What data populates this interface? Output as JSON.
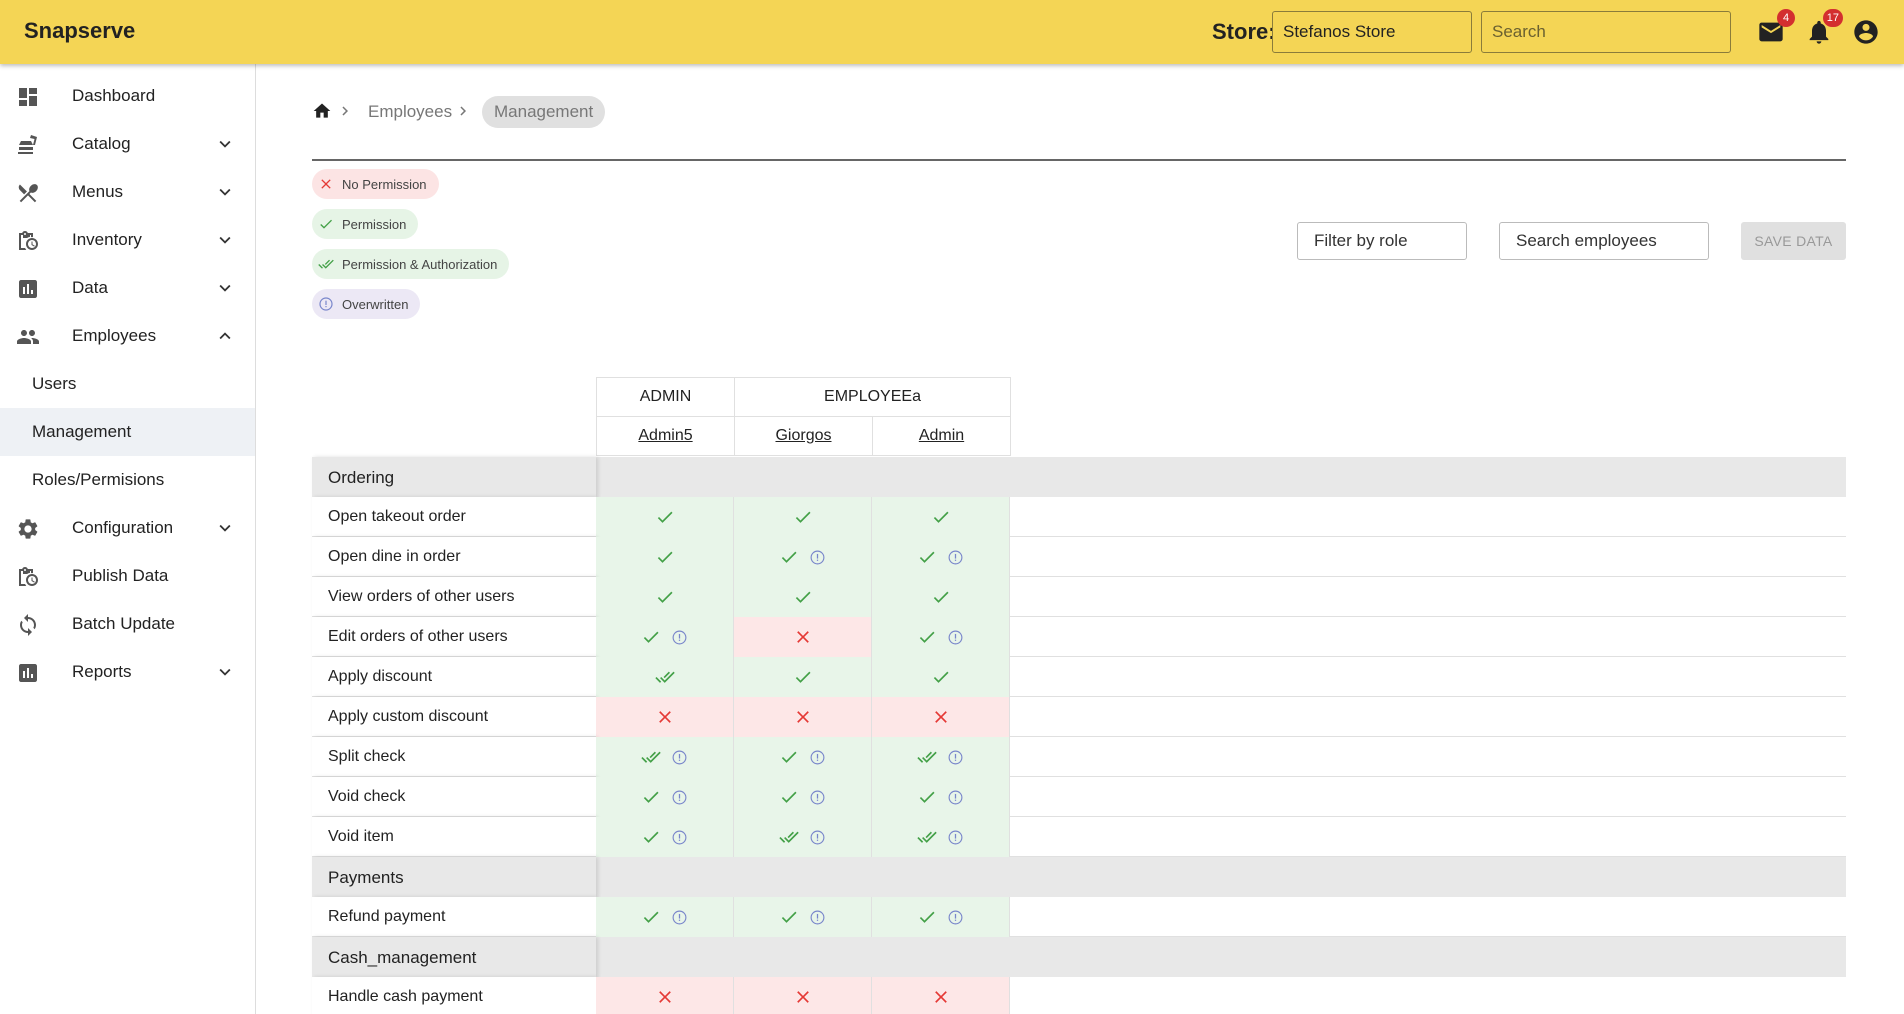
{
  "app": {
    "title": "Snapserve"
  },
  "topbar": {
    "store_label": "Store:",
    "store_value": "Stefanos Store",
    "search_placeholder": "Search",
    "mail_count": "4",
    "notif_count": "17"
  },
  "sidebar": {
    "items": [
      {
        "label": "Dashboard"
      },
      {
        "label": "Catalog"
      },
      {
        "label": "Menus"
      },
      {
        "label": "Inventory"
      },
      {
        "label": "Data"
      },
      {
        "label": "Employees"
      },
      {
        "label": "Users"
      },
      {
        "label": "Management"
      },
      {
        "label": "Roles/Permisions"
      },
      {
        "label": "Configuration"
      },
      {
        "label": "Publish Data"
      },
      {
        "label": "Batch Update"
      },
      {
        "label": "Reports"
      }
    ]
  },
  "breadcrumb": {
    "parent": "Employees",
    "current": "Management"
  },
  "legend": {
    "no_permission": "No Permission",
    "permission": "Permission",
    "permission_auth": "Permission & Authorization",
    "overwritten": "Overwritten"
  },
  "controls": {
    "filter_role": "Filter by role",
    "search_employees": "Search employees",
    "save": "SAVE DATA"
  },
  "table": {
    "roles": [
      {
        "name": "ADMIN"
      },
      {
        "name": "EMPLOYEEa"
      }
    ],
    "users": [
      {
        "name": "Admin5"
      },
      {
        "name": "Giorgos"
      },
      {
        "name": "Admin"
      }
    ],
    "sections": [
      {
        "name": "Ordering",
        "rows": [
          {
            "label": "Open takeout order",
            "cells": [
              [
                "p",
                false
              ],
              [
                "p",
                false
              ],
              [
                "p",
                false
              ]
            ]
          },
          {
            "label": "Open dine in order",
            "cells": [
              [
                "p",
                false
              ],
              [
                "p",
                true
              ],
              [
                "p",
                true
              ]
            ]
          },
          {
            "label": "View orders of other users",
            "cells": [
              [
                "p",
                false
              ],
              [
                "p",
                false
              ],
              [
                "p",
                false
              ]
            ]
          },
          {
            "label": "Edit orders of other users",
            "cells": [
              [
                "p",
                true
              ],
              [
                "n",
                false
              ],
              [
                "p",
                true
              ]
            ]
          },
          {
            "label": "Apply discount",
            "cells": [
              [
                "pa",
                false
              ],
              [
                "p",
                false
              ],
              [
                "p",
                false
              ]
            ]
          },
          {
            "label": "Apply custom discount",
            "cells": [
              [
                "n",
                false
              ],
              [
                "n",
                false
              ],
              [
                "n",
                false
              ]
            ]
          },
          {
            "label": "Split check",
            "cells": [
              [
                "pa",
                true
              ],
              [
                "p",
                true
              ],
              [
                "pa",
                true
              ]
            ]
          },
          {
            "label": "Void check",
            "cells": [
              [
                "p",
                true
              ],
              [
                "p",
                true
              ],
              [
                "p",
                true
              ]
            ]
          },
          {
            "label": "Void item",
            "cells": [
              [
                "p",
                true
              ],
              [
                "pa",
                true
              ],
              [
                "pa",
                true
              ]
            ]
          }
        ]
      },
      {
        "name": "Payments",
        "rows": [
          {
            "label": "Refund payment",
            "cells": [
              [
                "p",
                true
              ],
              [
                "p",
                true
              ],
              [
                "p",
                true
              ]
            ]
          }
        ]
      },
      {
        "name": "Cash_management",
        "rows": [
          {
            "label": "Handle cash payment",
            "cells": [
              [
                "n",
                false
              ],
              [
                "n",
                false
              ],
              [
                "n",
                false
              ]
            ]
          }
        ]
      }
    ]
  },
  "colors": {
    "topbar": "#f4d555",
    "permit": "#43a047",
    "deny": "#e53935",
    "overwritten": "#7986cb"
  }
}
